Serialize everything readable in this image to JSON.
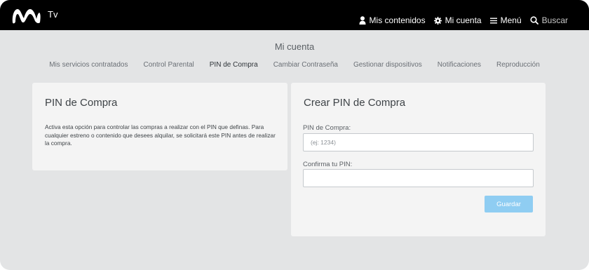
{
  "header": {
    "logo_suffix": "Tv",
    "nav": [
      {
        "label": "Mis contenidos",
        "icon": "user-icon"
      },
      {
        "label": "Mi cuenta",
        "icon": "gear-icon"
      },
      {
        "label": "Menú",
        "icon": "hamburger-icon"
      },
      {
        "label": "Buscar",
        "icon": "search-icon"
      }
    ]
  },
  "account": {
    "title": "Mi cuenta",
    "tabs": [
      {
        "label": "Mis servicios contratados",
        "active": false
      },
      {
        "label": "Control Parental",
        "active": false
      },
      {
        "label": "PIN de Compra",
        "active": true
      },
      {
        "label": "Cambiar Contraseña",
        "active": false
      },
      {
        "label": "Gestionar dispositivos",
        "active": false
      },
      {
        "label": "Notificaciones",
        "active": false
      },
      {
        "label": "Reproducción",
        "active": false
      }
    ]
  },
  "info_card": {
    "title": "PIN de Compra",
    "description": "Activa esta opción para controlar las compras a realizar con el PIN que definas. Para cualquier estreno o contenido que desees alquilar, se solicitará este PIN antes de realizar la compra."
  },
  "form_card": {
    "title": "Crear PIN de Compra",
    "pin_label": "PIN de Compra:",
    "pin_value": "",
    "pin_placeholder": "(ej: 1234)",
    "confirm_label": "Confirma tu PIN:",
    "confirm_value": "",
    "confirm_placeholder": "",
    "save_label": "Guardar"
  },
  "colors": {
    "header_bg": "#000000",
    "page_bg": "#e3e4e5",
    "card_bg": "#f4f4f4",
    "save_button": "#8fcdf2"
  }
}
